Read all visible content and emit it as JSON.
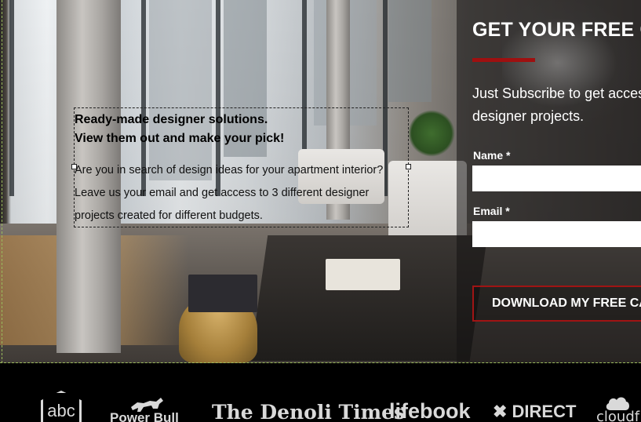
{
  "hero": {
    "headline_line1": "Ready-made designer solutions.",
    "headline_line2": "View them out and make your pick!",
    "body": "Are you in search of design ideas for your apartment interior? Leave us your email and get access to 3 different designer projects created for different budgets."
  },
  "cta": {
    "title": "GET YOUR FREE C",
    "subtitle_line1": "Just Subscribe to get acces",
    "subtitle_line2": "designer projects.",
    "name_label": "Name *",
    "email_label": "Email *",
    "button_label": "DOWNLOAD MY FREE CA",
    "accent_color": "#9e1010"
  },
  "logos": {
    "items": [
      "abc",
      "Power Bull",
      "The Denoli Times",
      "lifebook",
      "DIRECT",
      "cloudf"
    ]
  }
}
